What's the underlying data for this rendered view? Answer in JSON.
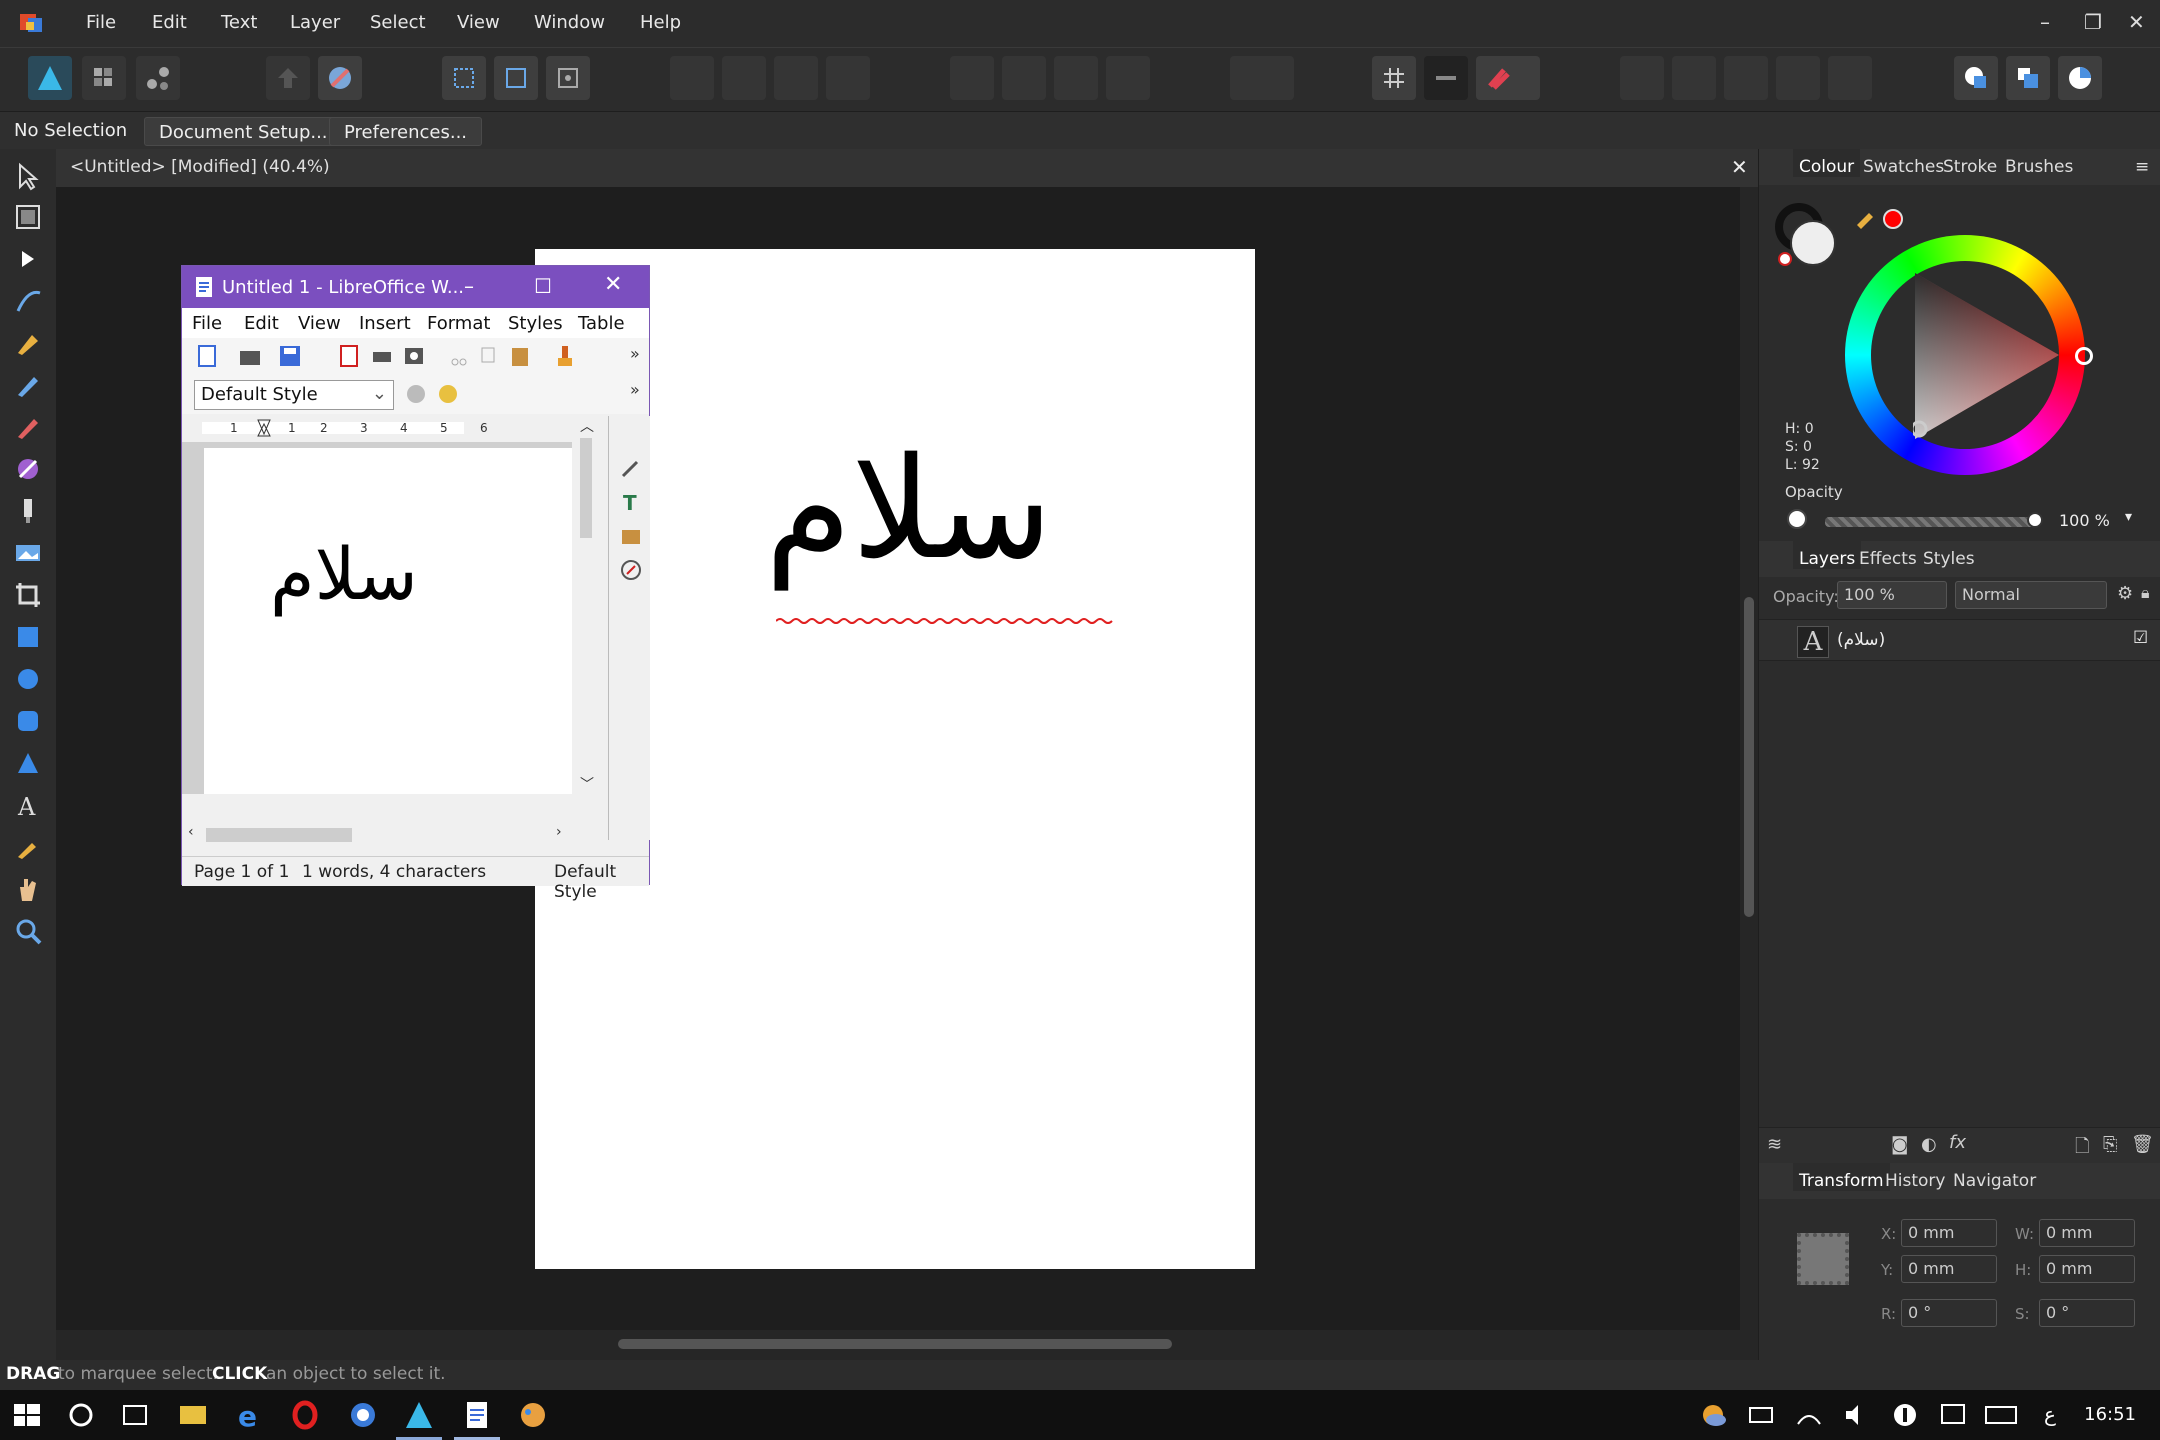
{
  "menu": [
    "File",
    "Edit",
    "Text",
    "Layer",
    "Select",
    "View",
    "Window",
    "Help"
  ],
  "context": {
    "no_selection": "No Selection",
    "doc_setup": "Document Setup...",
    "preferences": "Preferences..."
  },
  "doc": {
    "title": "<Untitled> [Modified] (40.4%)",
    "artboard_text": "سلام",
    "close": "✕"
  },
  "status": {
    "drag": "DRAG",
    "drag_desc": " to marquee select. ",
    "click": "CLICK",
    "click_desc": " an object to select it."
  },
  "panel": {
    "color_tabs": [
      "Colour",
      "Swatches",
      "Stroke",
      "Brushes"
    ],
    "hsl": {
      "h": "H: 0",
      "s": "S: 0",
      "l": "L: 92"
    },
    "opacity_label": "Opacity",
    "opacity_value": "100 %",
    "layer_tabs": [
      "Layers",
      "Effects",
      "Styles"
    ],
    "layer_opacity_label": "Opacity:",
    "layer_opacity": "100 %",
    "blend_mode": "Normal",
    "layer_name": "(سلام)",
    "transform_tabs": [
      "Transform",
      "History",
      "Navigator"
    ],
    "x_label": "X:",
    "x": "0 mm",
    "y_label": "Y:",
    "y": "0 mm",
    "w_label": "W:",
    "w": "0 mm",
    "h_label": "H:",
    "h": "0 mm",
    "r_label": "R:",
    "r": "0 °",
    "s_label": "S:",
    "s": "0 °"
  },
  "libreoffice": {
    "title": "Untitled 1 - LibreOffice W...",
    "menu": [
      "File",
      "Edit",
      "View",
      "Insert",
      "Format",
      "Styles",
      "Table"
    ],
    "style": "Default Style",
    "doc_text": "سلام",
    "page": "Page 1 of 1",
    "words": "1 words, 4 characters",
    "status_style": "Default Style"
  },
  "clock": "16:51",
  "lang": "ع",
  "colors": {
    "accent_purple": "#7b4fbf",
    "bg": "#2c2c2c"
  }
}
